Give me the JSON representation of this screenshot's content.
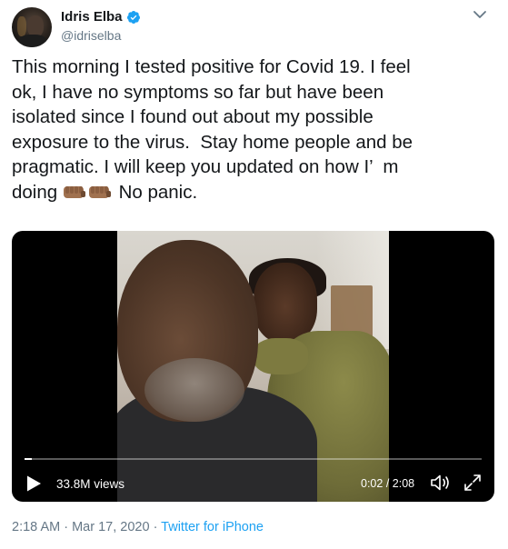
{
  "user": {
    "name": "Idris Elba",
    "handle": "@idriselba",
    "verified_color": "#1da1f2"
  },
  "tweet": {
    "lines": [
      "This morning I tested positive for Covid 19. I feel",
      "ok, I have no symptoms so far but have been",
      "isolated since I found out about my possible",
      "exposure to the virus.  Stay home people and be",
      "pragmatic. I will keep you updated on how I’  m",
      "doing",
      "No panic."
    ],
    "emoji": [
      "oncoming-fist-medium-dark-skin",
      "oncoming-fist-medium-dark-skin"
    ]
  },
  "video": {
    "views": "33.8M views",
    "time_current": "0:02",
    "time_separator": " / ",
    "time_total": "2:08",
    "progress": 0.016,
    "icons": [
      "play-icon",
      "volume-icon",
      "fullscreen-icon"
    ]
  },
  "meta": {
    "time": "2:18 AM",
    "separator1": " · ",
    "date": "Mar 17, 2020",
    "separator2": " · ",
    "source": "Twitter for iPhone"
  },
  "colors": {
    "text": "#14171a",
    "secondary": "#657786",
    "link": "#1da1f2"
  }
}
